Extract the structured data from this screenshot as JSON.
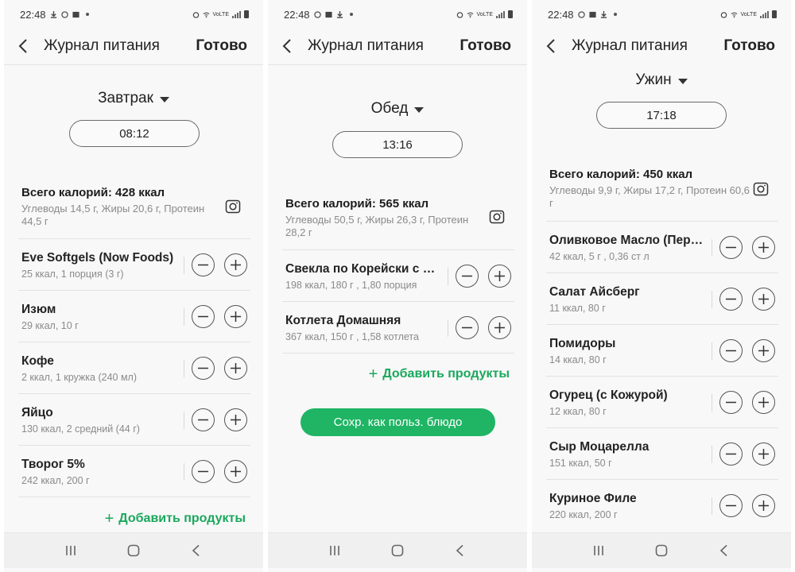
{
  "screens": [
    {
      "status": {
        "time": "22:48",
        "net": "VoLTE"
      },
      "appbar": {
        "title": "Журнал питания",
        "done": "Готово"
      },
      "meal": "Завтрак",
      "time": "08:12",
      "summary": {
        "total": "Всего калорий: 428 ккал",
        "macros": "Углеводы 14,5 г, Жиры 20,6 г, Протеин 44,5 г"
      },
      "items": [
        {
          "name": "Eve Softgels (Now Foods)",
          "sub": "25 ккал, 1 порция (3 г)"
        },
        {
          "name": "Изюм",
          "sub": "29 ккал, 10 г"
        },
        {
          "name": "Кофе",
          "sub": "2 ккал, 1 кружка (240 мл)"
        },
        {
          "name": "Яйцо",
          "sub": "130 ккал, 2 средний (44 г)"
        },
        {
          "name": "Творог 5%",
          "sub": "242 ккал, 200 г"
        }
      ],
      "add_label": "Добавить продукты"
    },
    {
      "status": {
        "time": "22:48",
        "net": "VoLTE"
      },
      "appbar": {
        "title": "Журнал питания",
        "done": "Готово"
      },
      "meal": "Обед",
      "time": "13:16",
      "summary": {
        "total": "Всего калорий: 565 ккал",
        "macros": "Углеводы 50,5 г, Жиры 26,3 г, Протеин 28,2 г"
      },
      "items": [
        {
          "name": "Свекла по Корейски с М...",
          "sub": "198 ккал, 180 г , 1,80 порция"
        },
        {
          "name": "Котлета Домашняя",
          "sub": "367 ккал, 150 г , 1,58 котлета"
        }
      ],
      "add_label": "Добавить продукты",
      "save_label": "Сохр. как польз. блюдо"
    },
    {
      "status": {
        "time": "22:48",
        "net": "VoLTE"
      },
      "appbar": {
        "title": "Журнал питания",
        "done": "Готово"
      },
      "meal": "Ужин",
      "time": "17:18",
      "summary": {
        "total": "Всего калорий: 450 ккал",
        "macros": "Углеводы 9,9 г, Жиры 17,2 г, Протеин 60,6 г"
      },
      "items": [
        {
          "name": "Оливковое Масло (Перв...",
          "sub": "42 ккал, 5 г , 0,36 ст л"
        },
        {
          "name": "Салат Айсберг",
          "sub": "11 ккал, 80 г"
        },
        {
          "name": "Помидоры",
          "sub": "14 ккал, 80 г"
        },
        {
          "name": "Огурец (с Кожурой)",
          "sub": "12 ккал, 80 г"
        },
        {
          "name": "Сыр Моцарелла",
          "sub": "151 ккал, 50 г"
        },
        {
          "name": "Куриное Филе",
          "sub": "220 ккал, 200 г"
        }
      ]
    }
  ],
  "colors": {
    "accent": "#1fb564",
    "accent_text": "#1aa85c",
    "background": "#f8f8f8"
  },
  "icons": {
    "back": "chevron-left-icon",
    "dropdown": "triangle-down-icon",
    "camera": "camera-icon",
    "minus": "minus-icon",
    "plus": "plus-icon",
    "nav_recent": "recent-apps-icon",
    "nav_home": "home-icon",
    "nav_back": "back-icon"
  }
}
